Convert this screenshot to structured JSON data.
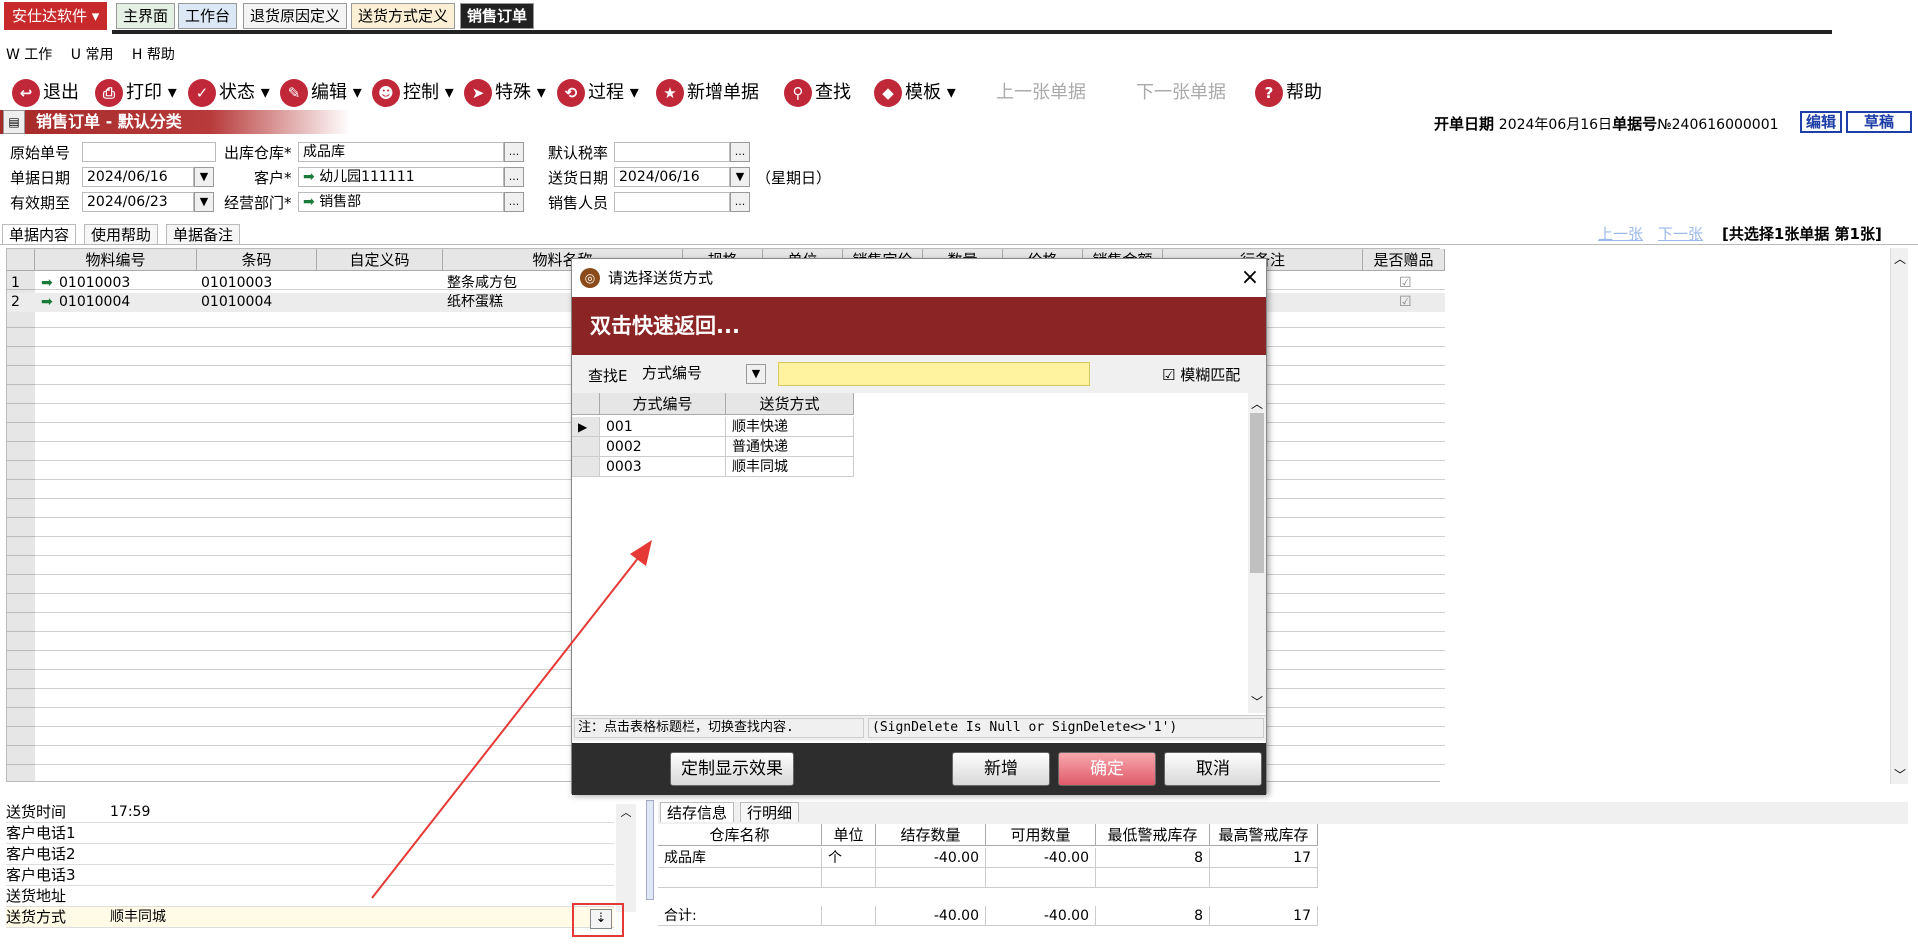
{
  "brand": "安仕达软件",
  "tabs": [
    {
      "label": "主界面",
      "bg": "#e4f0e4"
    },
    {
      "label": "工作台",
      "bg": "#dde8f6"
    },
    {
      "label": "退货原因定义",
      "bg": "#f4f4f4"
    },
    {
      "label": "送货方式定义",
      "bg": "#fbf0d6"
    },
    {
      "label": "销售订单",
      "bg": "#222222",
      "color": "#ffffff"
    }
  ],
  "menu": [
    "W 工作",
    "U 常用",
    "H 帮助"
  ],
  "toolbar": [
    {
      "label": "退出",
      "icon": "↩"
    },
    {
      "label": "打印 ▾",
      "icon": "⎙"
    },
    {
      "label": "状态 ▾",
      "icon": "✓"
    },
    {
      "label": "编辑 ▾",
      "icon": "✎"
    },
    {
      "label": "控制 ▾",
      "icon": "☻"
    },
    {
      "label": "特殊 ▾",
      "icon": "➤"
    },
    {
      "label": "过程 ▾",
      "icon": "⟲"
    },
    {
      "label": "新增单据",
      "icon": "★"
    },
    {
      "label": "查找",
      "icon": "⚲"
    },
    {
      "label": "模板 ▾",
      "icon": "◆"
    }
  ],
  "toolbar_disabled": [
    "上一张单据",
    "下一张单据"
  ],
  "toolbar_help": "帮助",
  "doc": {
    "title": "销售订单 - 默认分类",
    "open_date_label": "开单日期",
    "open_date": "2024年06月16日",
    "doc_no_label": "单据号",
    "doc_no": "№240616000001",
    "edit_btn": "编辑",
    "draft_btn": "草稿"
  },
  "form": {
    "orig_no_label": "原始单号",
    "orig_no": "",
    "warehouse_label": "出库仓库*",
    "warehouse": "成品库",
    "tax_label": "默认税率",
    "tax": "",
    "doc_date_label": "单据日期",
    "doc_date": "2024/06/16",
    "customer_label": "客户*",
    "customer": "幼儿园111111",
    "ship_date_label": "送货日期",
    "ship_date": "2024/06/16",
    "weekday": "（星期日）",
    "valid_label": "有效期至",
    "valid": "2024/06/23",
    "dept_label": "经营部门*",
    "dept": "销售部",
    "sales_label": "销售人员",
    "sales": ""
  },
  "subtabs": [
    "单据内容",
    "使用帮助",
    "单据备注"
  ],
  "nav": {
    "prev": "上一张",
    "next": "下一张",
    "summary": "[共选择1张单据  第1张]"
  },
  "grid": {
    "headers": [
      "物料编号",
      "条码",
      "自定义码",
      "物料名称",
      "规格",
      "单位",
      "销售定价",
      "数量",
      "价格",
      "销售金额",
      "行备注",
      "是否赠品"
    ],
    "rows": [
      {
        "no": "1",
        "code": "01010003",
        "barcode": "01010003",
        "name": "整条咸方包"
      },
      {
        "no": "2",
        "code": "01010004",
        "barcode": "01010004",
        "name": "纸杯蛋糕"
      }
    ]
  },
  "dialog": {
    "title": "请选择送货方式",
    "banner": "双击快速返回...",
    "search_label": "查找E",
    "search_field": "方式编号",
    "search_value": "",
    "fuzzy": "模糊匹配",
    "headers": [
      "方式编号",
      "送货方式"
    ],
    "rows": [
      [
        "001",
        "顺丰快递"
      ],
      [
        "0002",
        "普通快递"
      ],
      [
        "0003",
        "顺丰同城"
      ]
    ],
    "note": "注：点击表格标题栏，切换查找内容.",
    "filter": "(SignDelete Is Null or SignDelete<>'1')",
    "btn_custom": "定制显示效果",
    "btn_new": "新增",
    "btn_ok": "确定",
    "btn_cancel": "取消"
  },
  "info": [
    {
      "label": "送货时间",
      "value": "17:59"
    },
    {
      "label": "客户电话1",
      "value": ""
    },
    {
      "label": "客户电话2",
      "value": ""
    },
    {
      "label": "客户电话3",
      "value": ""
    },
    {
      "label": "送货地址",
      "value": ""
    },
    {
      "label": "送货方式",
      "value": "顺丰同城"
    }
  ],
  "stock": {
    "tabs": [
      "结存信息",
      "行明细"
    ],
    "headers": [
      "仓库名称",
      "单位",
      "结存数量",
      "可用数量",
      "最低警戒库存",
      "最高警戒库存"
    ],
    "row": [
      "成品库",
      "个",
      "-40.00",
      "-40.00",
      "8",
      "17"
    ],
    "total": [
      "合计:",
      "",
      "-40.00",
      "-40.00",
      "8",
      "17"
    ]
  },
  "accent": "#c0283a"
}
